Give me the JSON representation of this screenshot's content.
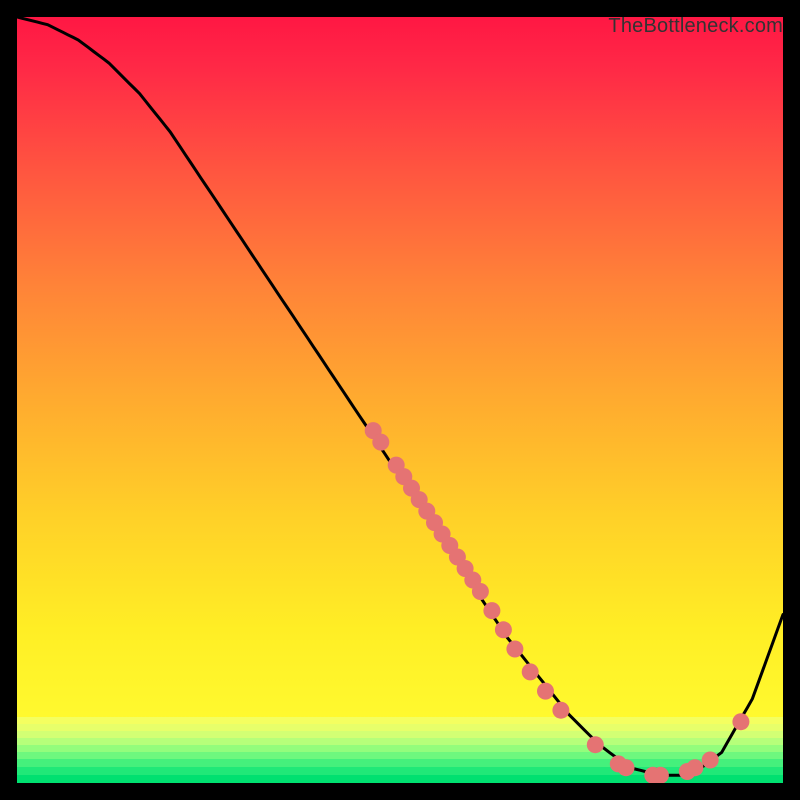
{
  "watermark": "TheBottleneck.com",
  "chart_data": {
    "type": "line",
    "title": "",
    "xlabel": "",
    "ylabel": "",
    "xlim": [
      0,
      100
    ],
    "ylim": [
      0,
      100
    ],
    "grid": false,
    "legend": false,
    "background_gradient": {
      "top_color": "#ff1744",
      "mid_color": "#ffeb3b",
      "bottom_accent": "#00e676"
    },
    "series": [
      {
        "name": "bottleneck-curve",
        "color": "#000000",
        "x": [
          0,
          4,
          8,
          12,
          16,
          20,
          24,
          28,
          32,
          36,
          40,
          44,
          48,
          52,
          56,
          60,
          64,
          68,
          72,
          76,
          80,
          84,
          88,
          92,
          96,
          100
        ],
        "y": [
          100,
          99,
          97,
          94,
          90,
          85,
          79,
          73,
          67,
          61,
          55,
          49,
          43,
          37,
          31,
          25,
          19,
          14,
          9,
          5,
          2,
          1,
          1,
          4,
          11,
          22
        ]
      }
    ],
    "points": {
      "name": "data-points",
      "color": "#e57373",
      "coords": [
        {
          "x": 46.5,
          "y": 46.0
        },
        {
          "x": 47.5,
          "y": 44.5
        },
        {
          "x": 49.5,
          "y": 41.5
        },
        {
          "x": 50.5,
          "y": 40.0
        },
        {
          "x": 51.5,
          "y": 38.5
        },
        {
          "x": 52.5,
          "y": 37.0
        },
        {
          "x": 53.5,
          "y": 35.5
        },
        {
          "x": 54.5,
          "y": 34.0
        },
        {
          "x": 55.5,
          "y": 32.5
        },
        {
          "x": 56.5,
          "y": 31.0
        },
        {
          "x": 57.5,
          "y": 29.5
        },
        {
          "x": 58.5,
          "y": 28.0
        },
        {
          "x": 59.5,
          "y": 26.5
        },
        {
          "x": 60.5,
          "y": 25.0
        },
        {
          "x": 62.0,
          "y": 22.5
        },
        {
          "x": 63.5,
          "y": 20.0
        },
        {
          "x": 65.0,
          "y": 17.5
        },
        {
          "x": 67.0,
          "y": 14.5
        },
        {
          "x": 69.0,
          "y": 12.0
        },
        {
          "x": 71.0,
          "y": 9.5
        },
        {
          "x": 75.5,
          "y": 5.0
        },
        {
          "x": 78.5,
          "y": 2.5
        },
        {
          "x": 79.5,
          "y": 2.0
        },
        {
          "x": 83.0,
          "y": 1.0
        },
        {
          "x": 84.0,
          "y": 1.0
        },
        {
          "x": 87.5,
          "y": 1.5
        },
        {
          "x": 88.5,
          "y": 2.0
        },
        {
          "x": 90.5,
          "y": 3.0
        },
        {
          "x": 94.5,
          "y": 8.0
        }
      ]
    }
  }
}
